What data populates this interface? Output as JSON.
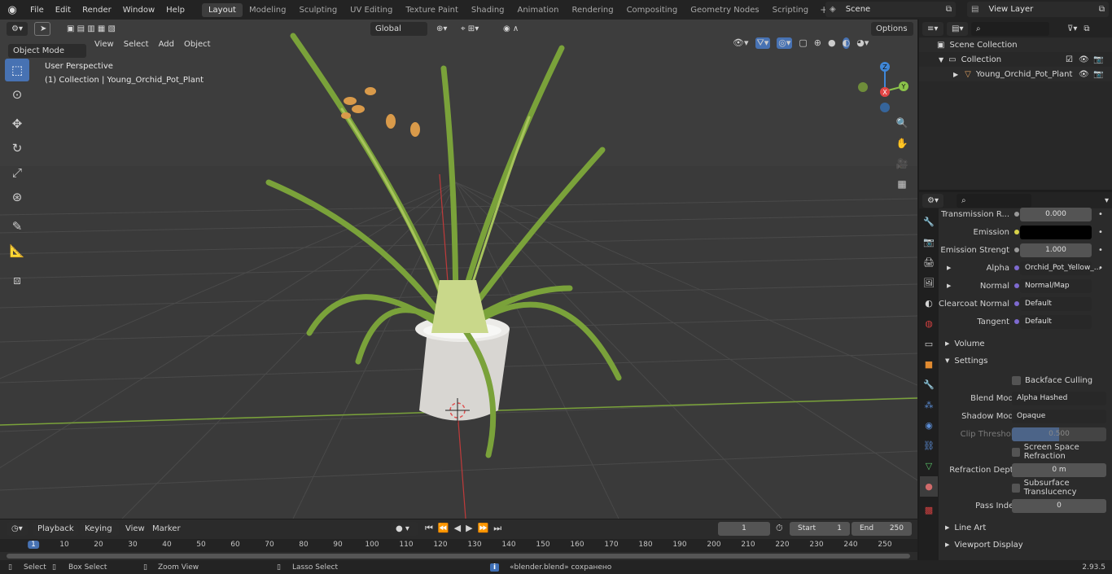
{
  "menu": [
    "File",
    "Edit",
    "Render",
    "Window",
    "Help"
  ],
  "workspace_tabs": [
    "Layout",
    "Modeling",
    "Sculpting",
    "UV Editing",
    "Texture Paint",
    "Shading",
    "Animation",
    "Rendering",
    "Compositing",
    "Geometry Nodes",
    "Scripting"
  ],
  "scene": {
    "name": "Scene",
    "view_layer": "View Layer"
  },
  "viewport": {
    "mode": "Object Mode",
    "menus": [
      "View",
      "Select",
      "Add",
      "Object"
    ],
    "transform_orientation": "Global",
    "options_label": "Options",
    "overlay_title": "User Perspective",
    "overlay_subtitle": "(1) Collection | Young_Orchid_Pot_Plant",
    "gizmo": {
      "x": "X",
      "y": "Y",
      "z": "Z"
    }
  },
  "outliner": {
    "scene_collection": "Scene Collection",
    "collection": "Collection",
    "object": "Young_Orchid_Pot_Plant"
  },
  "properties": {
    "rows": [
      {
        "label": "Transmission R...",
        "value": "0.000",
        "type": "num"
      },
      {
        "label": "Emission",
        "value": "",
        "type": "color"
      },
      {
        "label": "Emission Strengt",
        "value": "1.000",
        "type": "num"
      },
      {
        "label": "Alpha",
        "value": "Orchid_Pot_Yellow_...",
        "type": "link"
      },
      {
        "label": "Normal",
        "value": "Normal/Map",
        "type": "link"
      },
      {
        "label": "Clearcoat Normal",
        "value": "Default",
        "type": "link"
      },
      {
        "label": "Tangent",
        "value": "Default",
        "type": "link"
      }
    ],
    "sections": {
      "volume": "Volume",
      "settings": "Settings",
      "line_art": "Line Art",
      "viewport_display": "Viewport Display"
    },
    "settings": {
      "backface_culling": "Backface Culling",
      "blend_mode_label": "Blend Mode",
      "blend_mode": "Alpha Hashed",
      "shadow_mode_label": "Shadow Mode",
      "shadow_mode": "Opaque",
      "clip_threshold_label": "Clip Threshold",
      "clip_threshold": "0.500",
      "screen_space_refraction": "Screen Space Refraction",
      "refraction_depth_label": "Refraction Depth",
      "refraction_depth": "0 m",
      "subsurface_translucency": "Subsurface Translucency",
      "pass_index_label": "Pass Index",
      "pass_index": "0"
    }
  },
  "timeline": {
    "menus": [
      "Playback",
      "Keying",
      "View",
      "Marker"
    ],
    "current_frame": "1",
    "start_label": "Start",
    "start": "1",
    "end_label": "End",
    "end": "250",
    "ruler": [
      "1",
      "10",
      "20",
      "30",
      "40",
      "50",
      "60",
      "70",
      "80",
      "90",
      "100",
      "110",
      "120",
      "130",
      "140",
      "150",
      "160",
      "170",
      "180",
      "190",
      "200",
      "210",
      "220",
      "230",
      "240",
      "250"
    ]
  },
  "status": {
    "select": "Select",
    "box_select": "Box Select",
    "zoom_view": "Zoom View",
    "lasso_select": "Lasso Select",
    "message": "«blender.blend» сохранено",
    "version": "2.93.5"
  },
  "colors": {
    "accent": "#4772b3",
    "x_axis": "#e34545",
    "y_axis": "#8bc34a",
    "z_axis": "#3f87d8"
  }
}
